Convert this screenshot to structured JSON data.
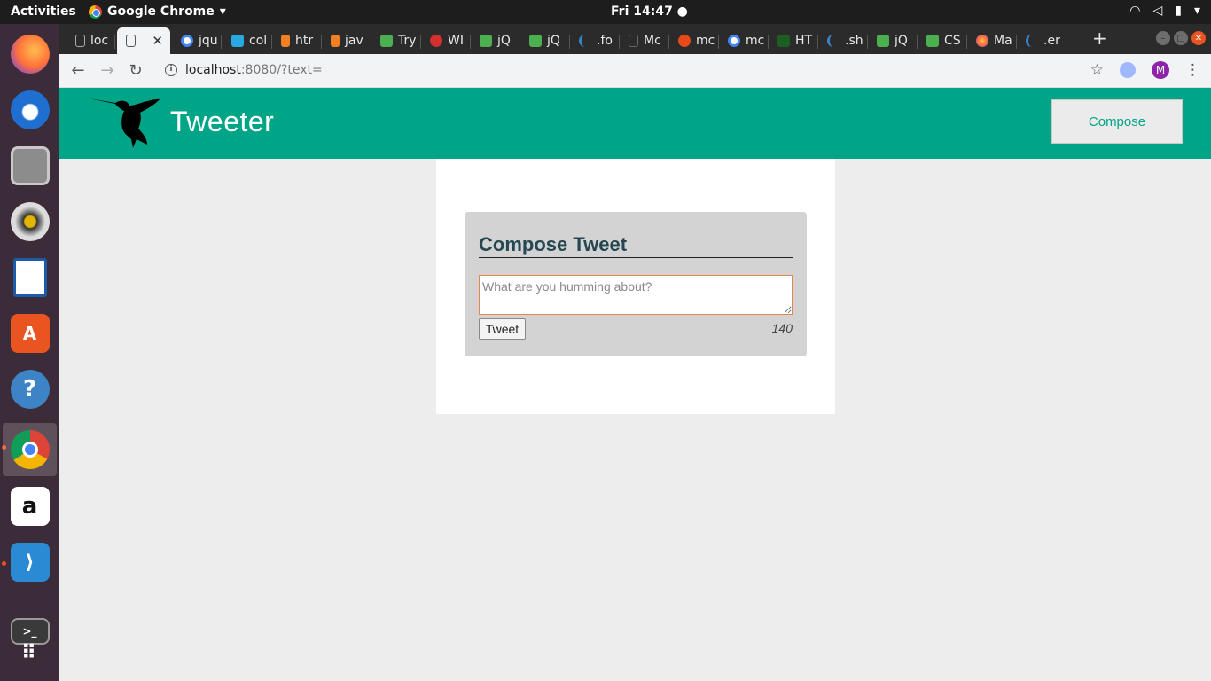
{
  "os_bar": {
    "activities": "Activities",
    "app_name": "Google Chrome",
    "app_menu_arrow": "▾",
    "clock": "Fri 14:47 ●"
  },
  "dock": {
    "items": [
      "firefox",
      "thunderbird",
      "files",
      "rhythmbox",
      "libreoffice-writer",
      "software-center",
      "help",
      "chrome",
      "amazon",
      "vscode",
      "terminal",
      "show-apps"
    ]
  },
  "tabs": [
    {
      "label": "loc",
      "icon": "page-icon"
    },
    {
      "label": "",
      "icon": "page-icon"
    },
    {
      "label": "jqu",
      "icon": "google-icon"
    },
    {
      "label": "col",
      "icon": "codepen-icon"
    },
    {
      "label": "htr",
      "icon": "stackoverflow-icon"
    },
    {
      "label": "jav",
      "icon": "stackoverflow-icon"
    },
    {
      "label": "Try",
      "icon": "w3schools-icon"
    },
    {
      "label": "WI",
      "icon": "red-icon"
    },
    {
      "label": "jQ",
      "icon": "w3schools-icon"
    },
    {
      "label": "jQ",
      "icon": "w3schools-icon"
    },
    {
      "label": ".fo",
      "icon": "blue-arc-icon"
    },
    {
      "label": "Mc",
      "icon": "page-icon"
    },
    {
      "label": "mc",
      "icon": "red-icon"
    },
    {
      "label": "mc",
      "icon": "google-icon"
    },
    {
      "label": "HT",
      "icon": "green-icon"
    },
    {
      "label": ".sh",
      "icon": "blue-arc-icon"
    },
    {
      "label": "jQ",
      "icon": "w3schools-icon"
    },
    {
      "label": "CS",
      "icon": "w3schools-icon"
    },
    {
      "label": "Ma",
      "icon": "firefox-icon"
    },
    {
      "label": ".er",
      "icon": "blue-arc-icon"
    }
  ],
  "browser": {
    "url_host": "localhost",
    "url_rest": ":8080/?text=",
    "avatar_letter": "M"
  },
  "site": {
    "title": "Tweeter",
    "compose_button": "Compose"
  },
  "compose": {
    "heading": "Compose Tweet",
    "placeholder": "What are you humming about?",
    "submit_label": "Tweet",
    "char_count": "140"
  },
  "colors": {
    "header_bg": "#00a587",
    "compose_heading": "#244751",
    "input_border": "#e2874f"
  }
}
